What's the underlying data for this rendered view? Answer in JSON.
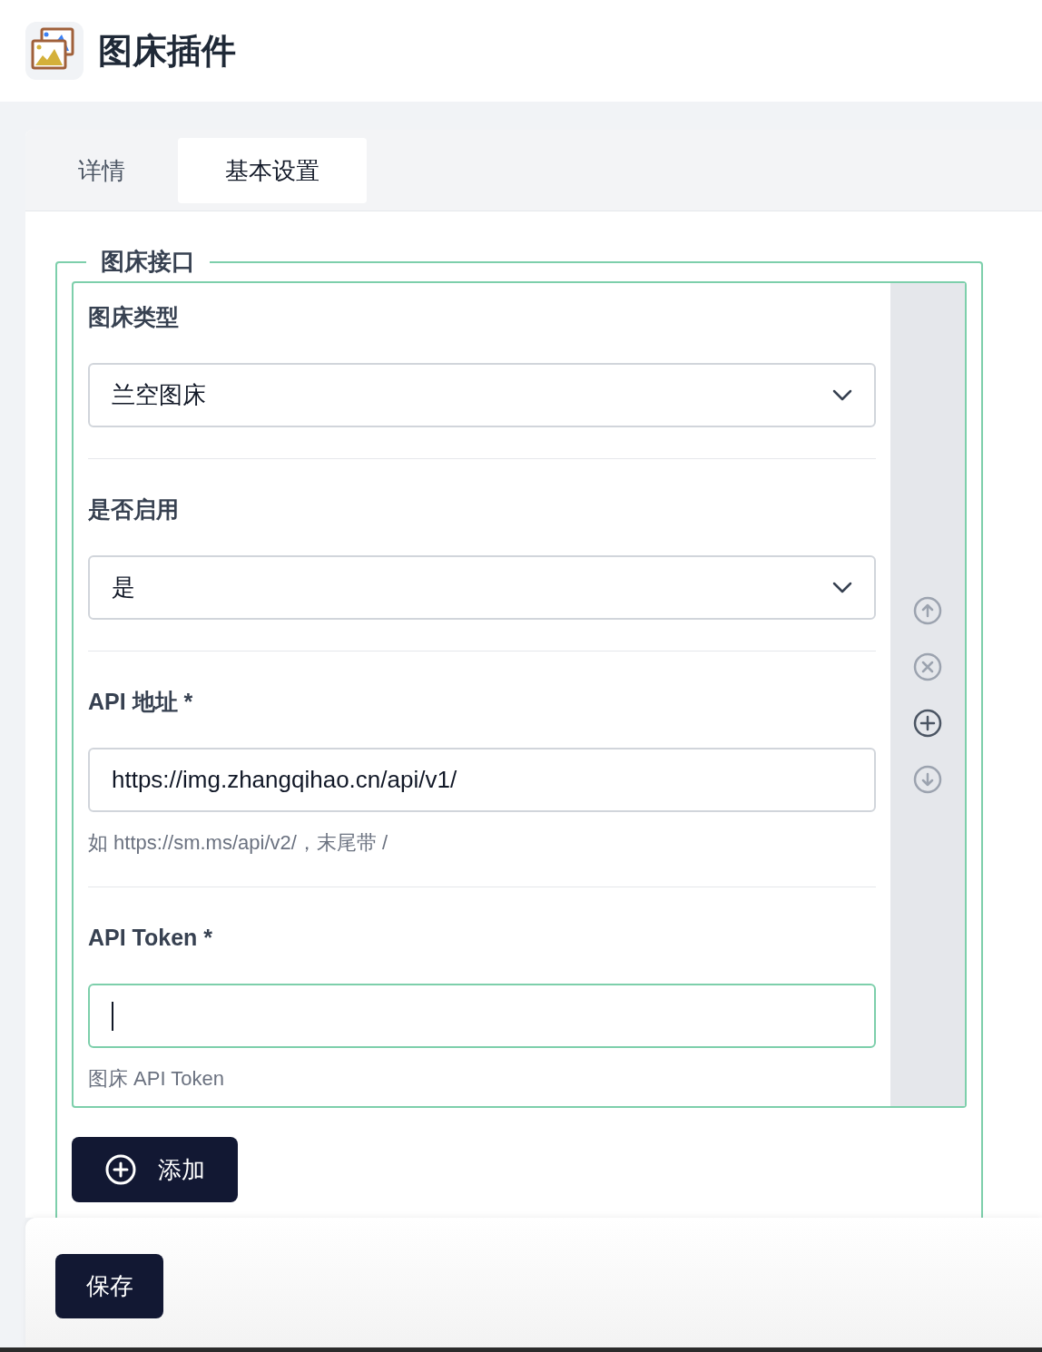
{
  "header": {
    "title": "图床插件"
  },
  "tabs": [
    {
      "label": "详情",
      "selected": false
    },
    {
      "label": "基本设置",
      "selected": true
    }
  ],
  "fieldset": {
    "legend": "图床接口",
    "fields": [
      {
        "kind": "select",
        "label": "图床类型",
        "value": "兰空图床"
      },
      {
        "kind": "select",
        "label": "是否启用",
        "value": "是"
      },
      {
        "kind": "input",
        "label": "API 地址 *",
        "value": "https://img.zhangqihao.cn/api/v1/",
        "help": "如 https://sm.ms/api/v2/，末尾带 /",
        "focused": false
      },
      {
        "kind": "input",
        "label": "API Token *",
        "help": "图床 API Token",
        "focused": true
      }
    ],
    "row_actions": [
      {
        "kind": "up",
        "disabled": true
      },
      {
        "kind": "remove",
        "disabled": true
      },
      {
        "kind": "add",
        "disabled": false
      },
      {
        "kind": "down",
        "disabled": true
      }
    ],
    "add_button": "添加"
  },
  "save_button": "保存"
}
